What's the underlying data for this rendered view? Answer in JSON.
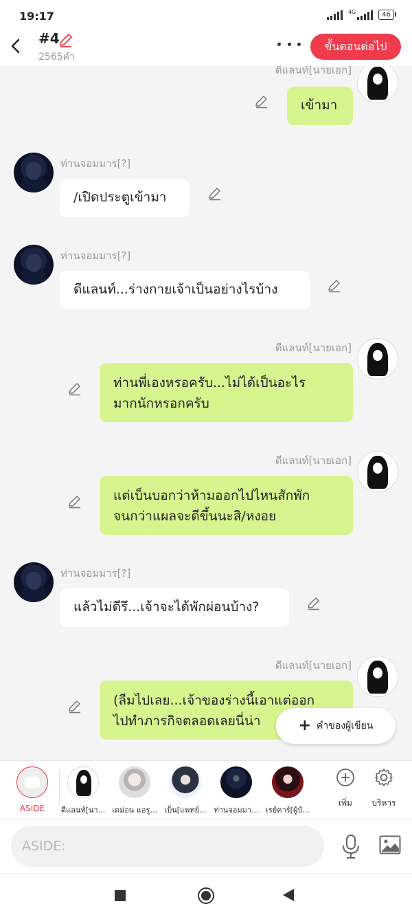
{
  "status": {
    "time": "19:17",
    "network": "4G",
    "battery": "46"
  },
  "header": {
    "title": "#4",
    "word_count": "2565คำ",
    "next_button": "ขั้นตอนต่อไป"
  },
  "messages": [
    {
      "side": "right",
      "speaker": "ดีแลนท์[นายเอก]",
      "avatar": "dylanth",
      "text": "เข้ามา"
    },
    {
      "side": "left",
      "speaker": "ท่านจอมมาร[?]",
      "avatar": "demon-lord",
      "text": "/เปิดประตูเข้ามา"
    },
    {
      "side": "left",
      "speaker": "ท่านจอมมาร[?]",
      "avatar": "demon-lord",
      "text": "ดีแลนท์...ร่างกายเจ้าเป็นอย่างไรบ้าง"
    },
    {
      "side": "right",
      "speaker": "ดีแลนท์[นายเอก]",
      "avatar": "dylanth",
      "text_lines": [
        "ท่านพี่เองหรอครับ...ไม่ได้เป็นอะไร",
        "มากนักหรอกครับ"
      ]
    },
    {
      "side": "right",
      "speaker": "ดีแลนท์[นายเอก]",
      "avatar": "dylanth",
      "text_lines": [
        "แต่เบ็นบอกว่าห้ามออกไปไหนสักพัก",
        "จนกว่าแผลจะดีขึ้นนะสิ/หงอย"
      ]
    },
    {
      "side": "left",
      "speaker": "ท่านจอมมาร[?]",
      "avatar": "demon-lord",
      "text": "แล้วไม่ดีรึ...เจ้าจะได้พักผ่อนบ้าง?"
    },
    {
      "side": "right",
      "speaker": "ดีแลนท์[นายเอก]",
      "avatar": "dylanth",
      "text_lines": [
        "(ลืมไปเลย...เจ้าของร่างนี้เอาแต่ออก",
        "ไปทำภารกิจตลอดเลยนี่น่า"
      ]
    }
  ],
  "author_note_button": "คำของผู้เขียน",
  "character_bar": {
    "aside_label": "ASIDE",
    "characters": [
      {
        "label": "ดีแลนท์[นา...",
        "avatar": "dylanth"
      },
      {
        "label": "เดม่อน แอรู...",
        "avatar": "white-hair"
      },
      {
        "label": "เบ็น[แพทย์...",
        "avatar": "glasses"
      },
      {
        "label": "ท่านจอมมา...",
        "avatar": "demon-lord"
      },
      {
        "label": "เรย์คาร์[ผู้บั...",
        "avatar": "red-hair"
      }
    ],
    "add_label": "เพิ่ม",
    "manage_label": "บริหาร"
  },
  "input": {
    "placeholder": "ASIDE:"
  },
  "colors": {
    "accent_red": "#ef3b4b",
    "bubble_right": "#d7f58f",
    "bubble_left": "#ffffff"
  }
}
